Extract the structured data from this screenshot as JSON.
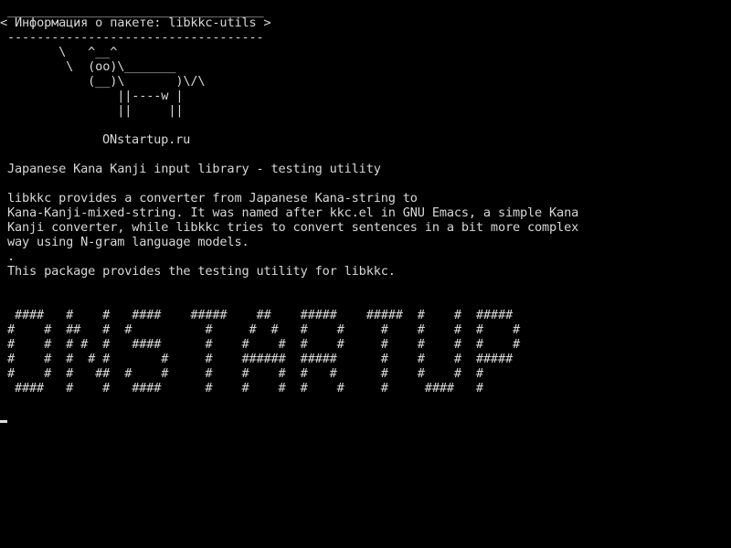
{
  "screen": {
    "background": "#000000",
    "foreground": "#d8d8d8"
  },
  "cowsay": {
    "top_border": " ___________________________________",
    "title": "< Информация о пакете: libkkc-utils >",
    "bottom_border": " -----------------------------------",
    "cow": [
      "        \\   ^__^",
      "         \\  (oo)\\_______",
      "            (__)\\       )\\/\\",
      "                ||----w |",
      "                ||     ||"
    ],
    "site": "ONstartup.ru"
  },
  "package": {
    "summary": "Japanese Kana Kanji input library - testing utility",
    "description": [
      "libkkc provides a converter from Japanese Kana-string to",
      "Kana-Kanji-mixed-string. It was named after kkc.el in GNU Emacs, a simple Kana",
      "Kanji converter, while libkkc tries to convert sentences in a bit more complex",
      "way using N-gram language models.",
      ".",
      "This package provides the testing utility for libkkc."
    ]
  },
  "banner": [
    " ####   #    #   ####    #####    ##    #####    #####  #    #  #####",
    "#    #  ##   #  #          #     #  #   #    #     #    #    #  #    #",
    "#    #  # #  #   ####      #    #    #  #    #     #    #    #  #    #",
    "#    #  #  # #       #     #    ######  #####      #    #    #  #####",
    "#    #  #   ##  #    #     #    #    #  #   #      #    #    #  #",
    " ####   #    #   ####      #    #    #  #    #     #     ####   #"
  ]
}
